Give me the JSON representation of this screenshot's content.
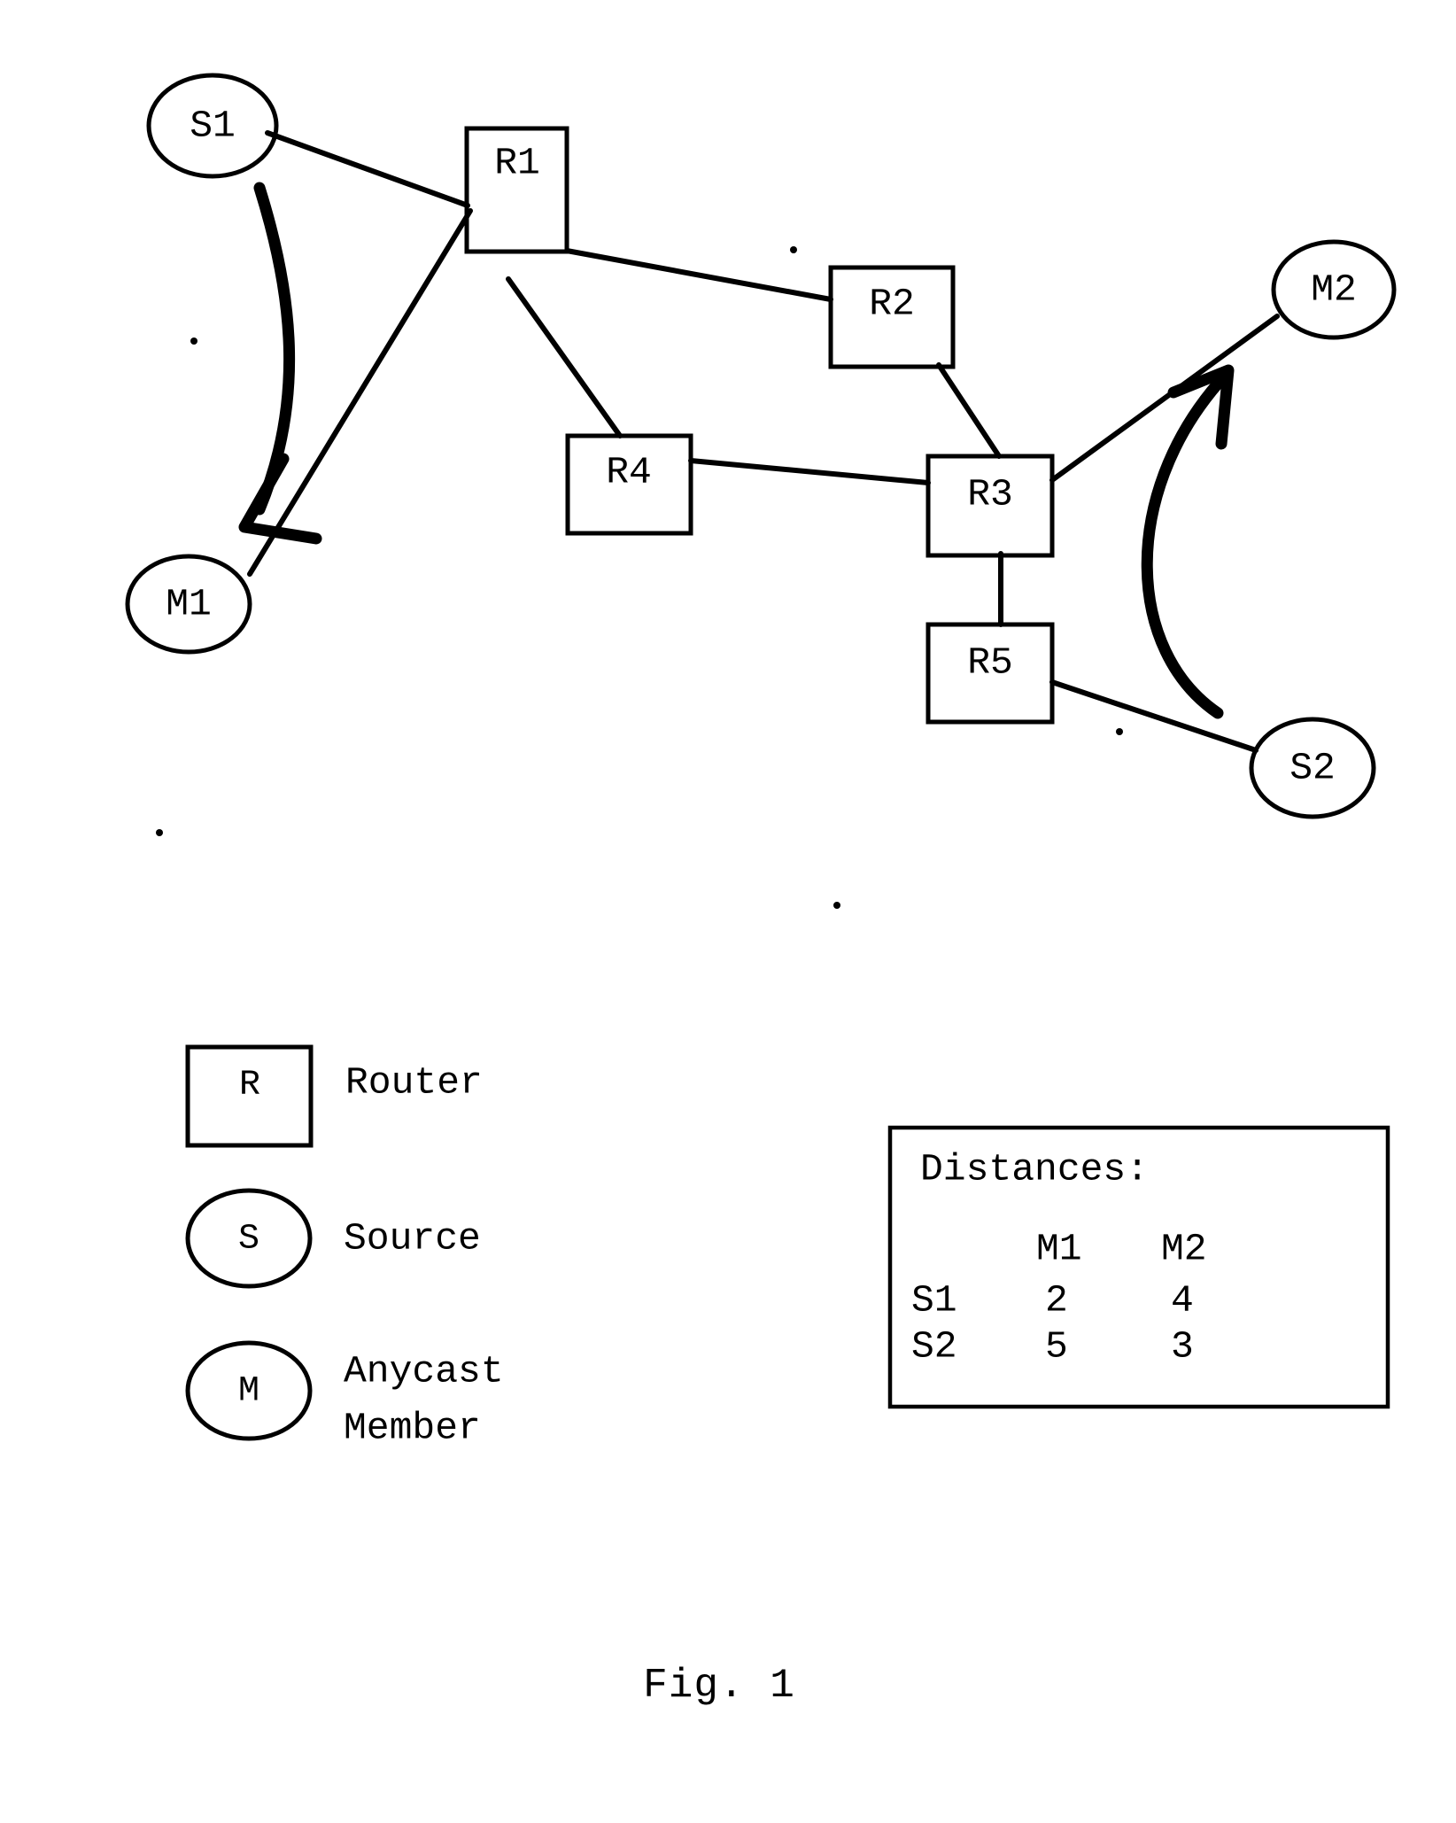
{
  "figure": {
    "caption": "Fig. 1"
  },
  "topology": {
    "sources": [
      {
        "id": "S1",
        "label": "S1"
      },
      {
        "id": "S2",
        "label": "S2"
      }
    ],
    "members": [
      {
        "id": "M1",
        "label": "M1"
      },
      {
        "id": "M2",
        "label": "M2"
      }
    ],
    "routers": [
      {
        "id": "R1",
        "label": "R1"
      },
      {
        "id": "R2",
        "label": "R2"
      },
      {
        "id": "R3",
        "label": "R3"
      },
      {
        "id": "R4",
        "label": "R4"
      },
      {
        "id": "R5",
        "label": "R5"
      }
    ],
    "links": [
      {
        "from": "S1",
        "to": "R1"
      },
      {
        "from": "R1",
        "to": "M1"
      },
      {
        "from": "R1",
        "to": "R2"
      },
      {
        "from": "R1",
        "to": "R4"
      },
      {
        "from": "R2",
        "to": "R3"
      },
      {
        "from": "R4",
        "to": "R3"
      },
      {
        "from": "R3",
        "to": "R5"
      },
      {
        "from": "R3",
        "to": "M2"
      },
      {
        "from": "R5",
        "to": "S2"
      }
    ],
    "flows": [
      {
        "from": "S1",
        "to": "M1"
      },
      {
        "from": "S2",
        "to": "M2"
      }
    ]
  },
  "legend": {
    "items": [
      {
        "glyph": "R",
        "shape": "square",
        "label": "Router"
      },
      {
        "glyph": "S",
        "shape": "ellipse",
        "label": "Source"
      },
      {
        "glyph": "M",
        "shape": "ellipse",
        "label_line1": "Anycast",
        "label_line2": "Member"
      }
    ]
  },
  "distances": {
    "title": "Distances:",
    "column_headers": [
      "M1",
      "M2"
    ],
    "row_headers": [
      "S1",
      "S2"
    ],
    "rows": [
      {
        "source": "S1",
        "values": [
          "2",
          "4"
        ]
      },
      {
        "source": "S2",
        "values": [
          "5",
          "3"
        ]
      }
    ]
  },
  "colors": {
    "ink": "#000000",
    "paper": "#ffffff"
  }
}
